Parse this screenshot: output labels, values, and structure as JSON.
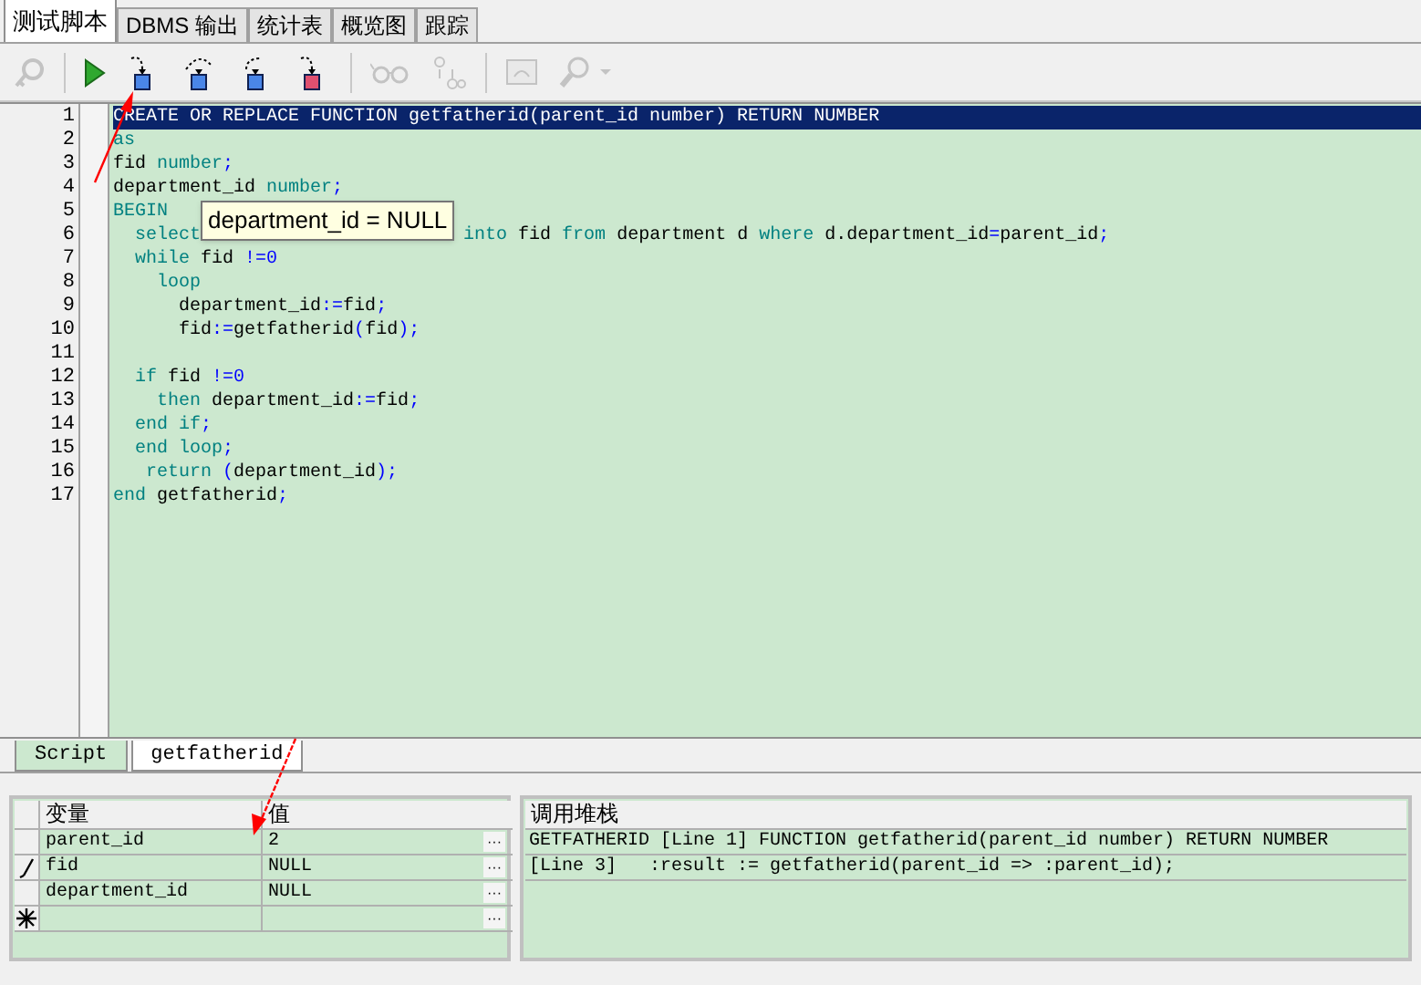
{
  "tabs": [
    {
      "label": "测试脚本",
      "selected": true
    },
    {
      "label": "DBMS 输出",
      "selected": false
    },
    {
      "label": "统计表",
      "selected": false
    },
    {
      "label": "概览图",
      "selected": false
    },
    {
      "label": "跟踪",
      "selected": false
    }
  ],
  "toolbar": [
    {
      "kind": "wizard",
      "disabled": true
    },
    {
      "kind": "run",
      "disabled": false
    },
    {
      "kind": "step_into",
      "disabled": false
    },
    {
      "kind": "step_over",
      "disabled": false
    },
    {
      "kind": "step_out",
      "disabled": false
    },
    {
      "kind": "run_to_exception",
      "disabled": false
    },
    {
      "kind": "watch",
      "disabled": true
    },
    {
      "kind": "variables",
      "disabled": true
    },
    {
      "kind": "monitor",
      "disabled": true
    },
    {
      "kind": "find",
      "disabled": true
    }
  ],
  "editor": {
    "lines": [
      {
        "number": "1",
        "selected": true,
        "tokens": [
          {
            "text": "CREATE OR REPLACE FUNCTION getfatherid(parent_id number) RETURN NUMBER",
            "kind": "plain"
          }
        ]
      },
      {
        "number": "2",
        "selected": false,
        "tokens": [
          {
            "text": "as",
            "kind": "keyword"
          }
        ]
      },
      {
        "number": "3",
        "selected": false,
        "tokens": [
          {
            "text": "fid ",
            "kind": "plain"
          },
          {
            "text": "number",
            "kind": "keyword"
          },
          {
            "text": ";",
            "kind": "op"
          }
        ]
      },
      {
        "number": "4",
        "selected": false,
        "tokens": [
          {
            "text": "department_id ",
            "kind": "plain"
          },
          {
            "text": "number",
            "kind": "keyword"
          },
          {
            "text": ";",
            "kind": "op"
          }
        ]
      },
      {
        "number": "5",
        "selected": false,
        "tokens": [
          {
            "text": "BEGIN",
            "kind": "keyword"
          }
        ]
      },
      {
        "number": "6",
        "selected": false,
        "tokens": [
          {
            "text": "  select",
            "kind": "keyword"
          },
          {
            "text": "into",
            "kind": "keyword",
            "gap": true
          },
          {
            "text": " fid ",
            "kind": "plain"
          },
          {
            "text": "from",
            "kind": "keyword"
          },
          {
            "text": " department d ",
            "kind": "plain"
          },
          {
            "text": "where",
            "kind": "keyword"
          },
          {
            "text": " d.department_id",
            "kind": "plain"
          },
          {
            "text": "=",
            "kind": "op"
          },
          {
            "text": "parent_id",
            "kind": "plain"
          },
          {
            "text": ";",
            "kind": "op"
          }
        ]
      },
      {
        "number": "7",
        "selected": false,
        "tokens": [
          {
            "text": "  while",
            "kind": "keyword"
          },
          {
            "text": " fid ",
            "kind": "plain"
          },
          {
            "text": "!=0",
            "kind": "op"
          }
        ]
      },
      {
        "number": "8",
        "selected": false,
        "tokens": [
          {
            "text": "    loop",
            "kind": "keyword"
          }
        ]
      },
      {
        "number": "9",
        "selected": false,
        "tokens": [
          {
            "text": "      department_id",
            "kind": "plain"
          },
          {
            "text": ":=",
            "kind": "op"
          },
          {
            "text": "fid",
            "kind": "plain"
          },
          {
            "text": ";",
            "kind": "op"
          }
        ]
      },
      {
        "number": "10",
        "selected": false,
        "tokens": [
          {
            "text": "      fid",
            "kind": "plain"
          },
          {
            "text": ":=",
            "kind": "op"
          },
          {
            "text": "getfatherid",
            "kind": "plain"
          },
          {
            "text": "(",
            "kind": "op"
          },
          {
            "text": "fid",
            "kind": "plain"
          },
          {
            "text": ");",
            "kind": "op"
          }
        ]
      },
      {
        "number": "11"
      },
      {
        "number": "12",
        "selected": false,
        "tokens": [
          {
            "text": "  if",
            "kind": "keyword"
          },
          {
            "text": " fid ",
            "kind": "plain"
          },
          {
            "text": "!=0",
            "kind": "op"
          }
        ]
      },
      {
        "number": "13",
        "selected": false,
        "tokens": [
          {
            "text": "    then",
            "kind": "keyword"
          },
          {
            "text": " department_id",
            "kind": "plain"
          },
          {
            "text": ":=",
            "kind": "op"
          },
          {
            "text": "fid",
            "kind": "plain"
          },
          {
            "text": ";",
            "kind": "op"
          }
        ]
      },
      {
        "number": "14",
        "selected": false,
        "tokens": [
          {
            "text": "  end if",
            "kind": "keyword"
          },
          {
            "text": ";",
            "kind": "op"
          }
        ]
      },
      {
        "number": "15",
        "selected": false,
        "tokens": [
          {
            "text": "  end loop",
            "kind": "keyword"
          },
          {
            "text": ";",
            "kind": "op"
          }
        ]
      },
      {
        "number": "16",
        "selected": false,
        "tokens": [
          {
            "text": "   return",
            "kind": "keyword"
          },
          {
            "text": " (",
            "kind": "op"
          },
          {
            "text": "department_id",
            "kind": "plain"
          },
          {
            "text": ");",
            "kind": "op"
          }
        ]
      },
      {
        "number": "17",
        "selected": false,
        "tokens": [
          {
            "text": "end",
            "kind": "keyword"
          },
          {
            "text": " getfatherid",
            "kind": "plain"
          },
          {
            "text": ";",
            "kind": "op"
          }
        ]
      }
    ],
    "tooltip": "department_id = NULL"
  },
  "bottom_tabs": [
    {
      "label": "Script",
      "selected": false
    },
    {
      "label": "getfatherid",
      "selected": true
    }
  ],
  "variables": {
    "columns": [
      "变量",
      "值"
    ],
    "rows": [
      {
        "kind": "plain",
        "name": "parent_id",
        "value": "2",
        "ellipsis": "···"
      },
      {
        "kind": "edit",
        "name": "fid",
        "value": "NULL",
        "ellipsis": "···"
      },
      {
        "kind": "plain",
        "name": "department_id",
        "value": "NULL",
        "ellipsis": "···"
      },
      {
        "kind": "new",
        "ellipsis": "···"
      }
    ]
  },
  "call_stack": {
    "title": "调用堆栈",
    "lines": [
      "GETFATHERID [Line 1] FUNCTION getfatherid(parent_id number) RETURN NUMBER",
      "[Line 3]   :result := getfatherid(parent_id => :parent_id);"
    ]
  }
}
